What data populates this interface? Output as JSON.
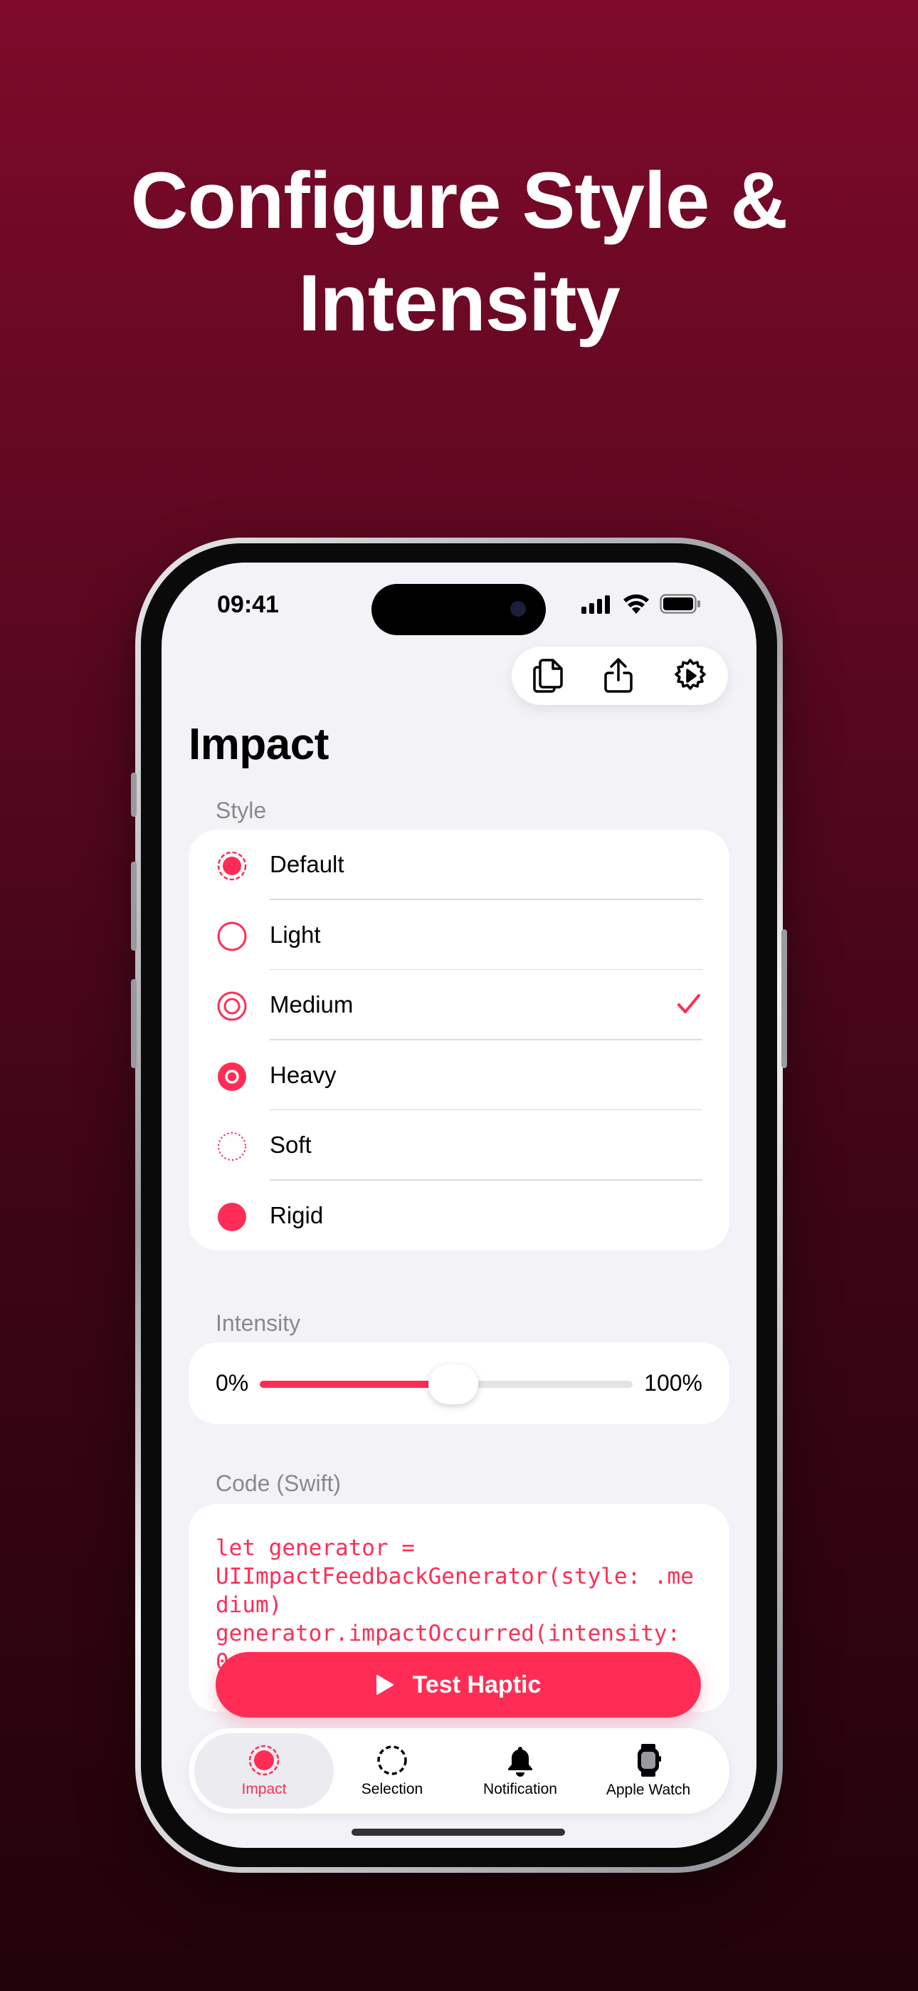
{
  "headline": "Configure Style & Intensity",
  "status_bar": {
    "time": "09:41"
  },
  "top_actions": [
    {
      "name": "copy-icon"
    },
    {
      "name": "share-icon"
    },
    {
      "name": "settings-icon"
    }
  ],
  "page_title": "Impact",
  "style_section": {
    "label": "Style",
    "options": [
      {
        "label": "Default",
        "icon": "default-radio-icon",
        "selected": false
      },
      {
        "label": "Light",
        "icon": "light-radio-icon",
        "selected": false
      },
      {
        "label": "Medium",
        "icon": "medium-radio-icon",
        "selected": true
      },
      {
        "label": "Heavy",
        "icon": "heavy-radio-icon",
        "selected": false
      },
      {
        "label": "Soft",
        "icon": "soft-radio-icon",
        "selected": false
      },
      {
        "label": "Rigid",
        "icon": "rigid-radio-icon",
        "selected": false
      }
    ]
  },
  "intensity_section": {
    "label": "Intensity",
    "min_label": "0%",
    "max_label": "100%",
    "value": 0.5
  },
  "code_section": {
    "label": "Code (Swift)",
    "code": "let generator =\nUIImpactFeedbackGenerator(style: .medium)\ngenerator.impactOccurred(intensity:\n0.5)"
  },
  "test_button": {
    "label": "Test Haptic"
  },
  "tabs": [
    {
      "label": "Impact",
      "icon": "impact-tab-icon",
      "active": true
    },
    {
      "label": "Selection",
      "icon": "selection-tab-icon",
      "active": false
    },
    {
      "label": "Notification",
      "icon": "bell-icon",
      "active": false
    },
    {
      "label": "Apple Watch",
      "icon": "watch-icon",
      "active": false
    }
  ],
  "colors": {
    "accent": "#ff2d55",
    "background_top": "#7e0a2a",
    "background_bottom": "#220309",
    "screen_bg": "#f2f2f7"
  }
}
